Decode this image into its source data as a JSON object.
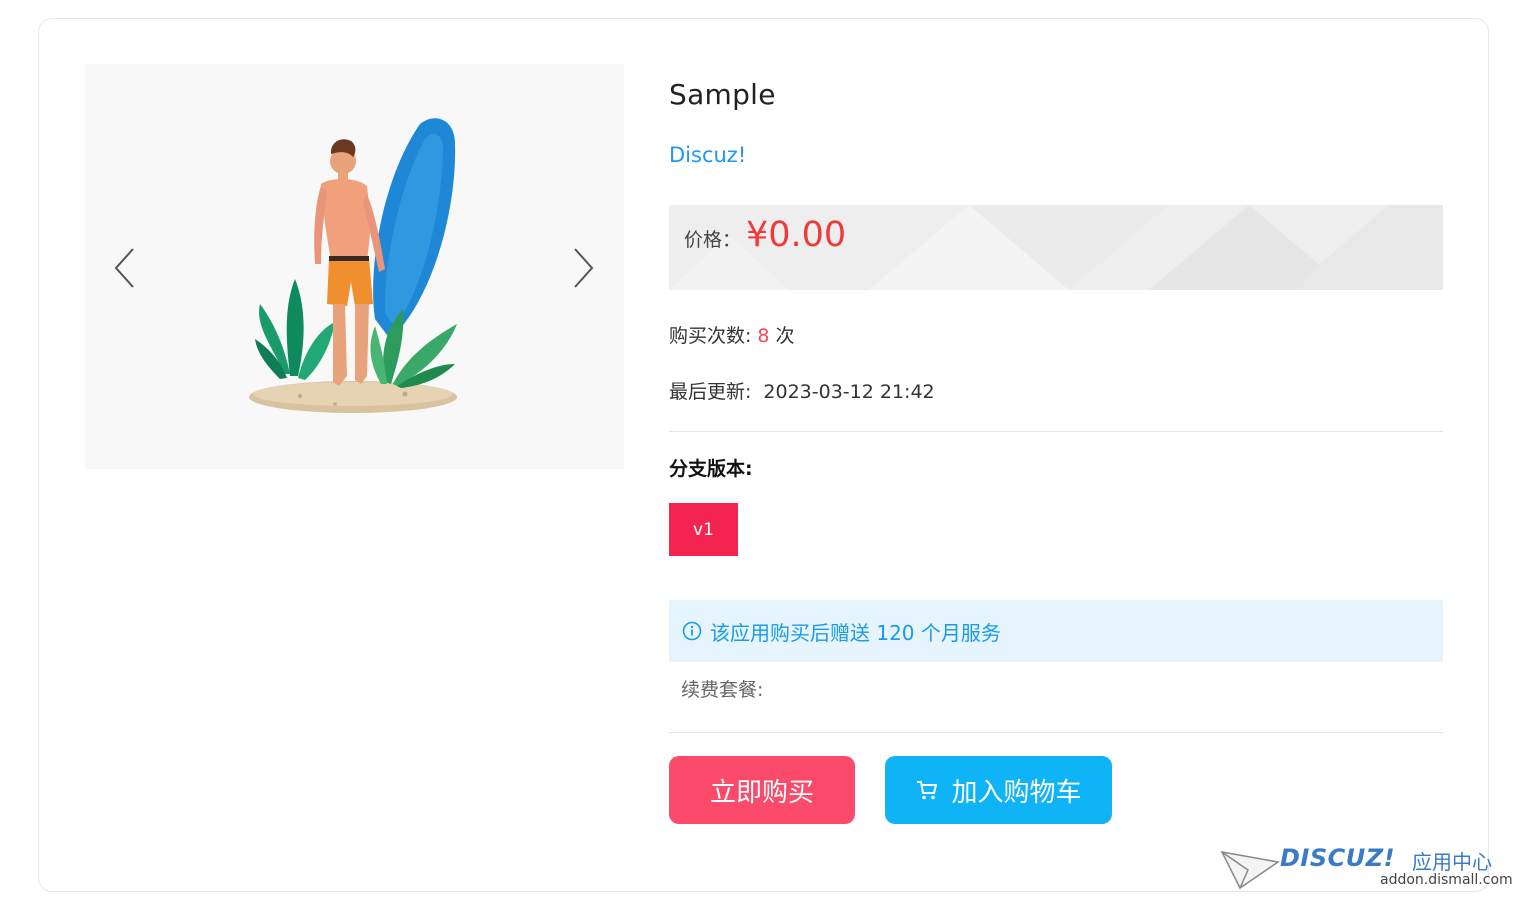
{
  "product": {
    "title": "Sample",
    "author": "Discuz!"
  },
  "price": {
    "label": "价格：",
    "value": "¥0.00"
  },
  "meta": {
    "purchases_label": "购买次数:",
    "purchases_count": "8",
    "purchases_unit": "次",
    "updated_label": "最后更新:",
    "updated_value": "2023-03-12 21:42"
  },
  "branch": {
    "title": "分支版本:",
    "versions": [
      "v1"
    ]
  },
  "notice": {
    "text": "该应用购买后赠送 120 个月服务",
    "icon": "info-icon"
  },
  "renew": {
    "label": "续费套餐:"
  },
  "actions": {
    "buy_label": "立即购买",
    "cart_label": "加入购物车",
    "cart_icon": "cart-icon"
  },
  "gallery": {
    "prev_icon": "chevron-left-icon",
    "next_icon": "chevron-right-icon"
  },
  "watermark": {
    "brand": "DISCUZ!",
    "brand_cn": "应用中心",
    "url": "addon.dismall.com"
  },
  "colors": {
    "accent_red": "#f3244f",
    "price_red": "#f03a3a",
    "buy_pink": "#fb4a6a",
    "cart_blue": "#0fb4f6",
    "link_blue": "#2196f3",
    "notice_bg": "#e6f4fd"
  }
}
